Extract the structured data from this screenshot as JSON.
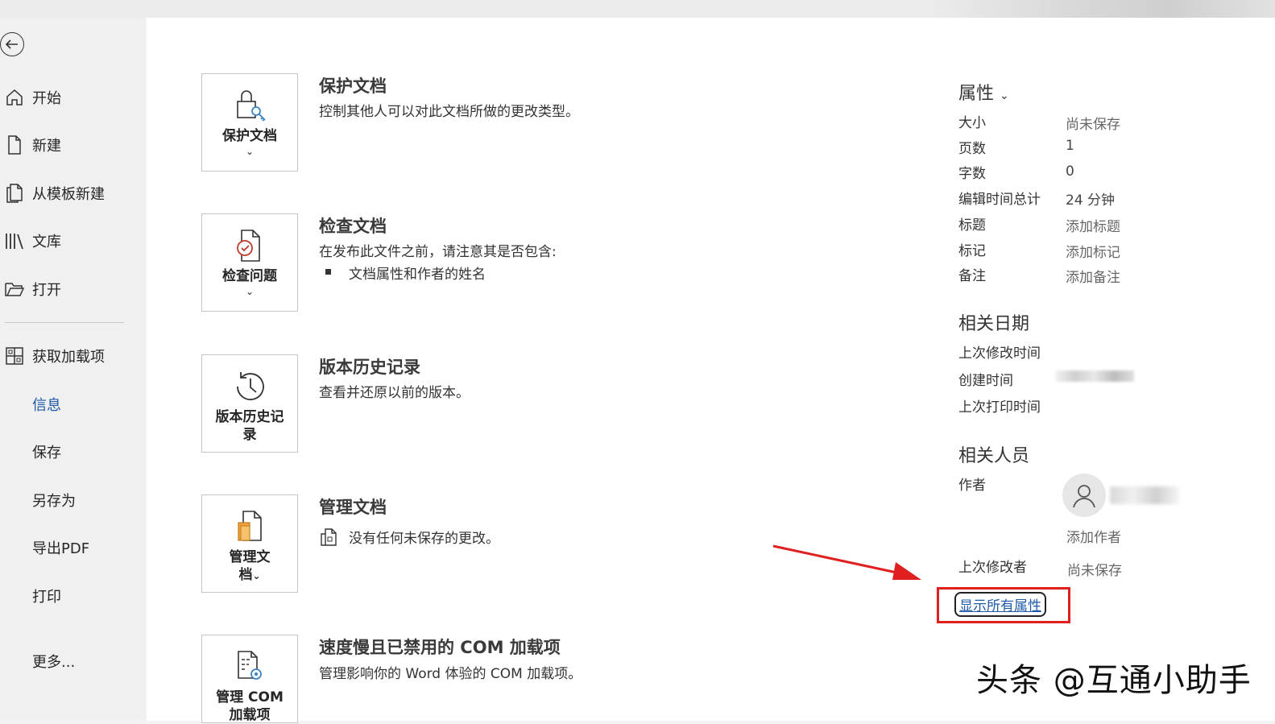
{
  "nav": {
    "items": [
      {
        "label": "开始",
        "icon": "home-icon"
      },
      {
        "label": "新建",
        "icon": "new-document-icon"
      },
      {
        "label": "从模板新建",
        "icon": "template-icon"
      },
      {
        "label": "文库",
        "icon": "library-icon"
      },
      {
        "label": "打开",
        "icon": "folder-open-icon"
      },
      {
        "label": "获取加载项",
        "icon": "addins-grid-icon"
      },
      {
        "label": "信息",
        "active": true
      },
      {
        "label": "保存"
      },
      {
        "label": "另存为"
      },
      {
        "label": "导出PDF"
      },
      {
        "label": "打印"
      },
      {
        "label": "更多..."
      }
    ]
  },
  "sections": [
    {
      "tile_label": "保护文档",
      "tile_chevron": "⌄",
      "title": "保护文档",
      "desc": "控制其他人可以对此文档所做的更改类型。",
      "icon": "lock-key-icon"
    },
    {
      "tile_label": "检查问题",
      "tile_chevron": "⌄",
      "title": "检查文档",
      "desc": "在发布此文件之前，请注意其是否包含:",
      "bullet": "文档属性和作者的姓名",
      "icon": "inspect-document-icon"
    },
    {
      "tile_label_line1": "版本历史记",
      "tile_label_line2": "录",
      "title": "版本历史记录",
      "desc": "查看并还原以前的版本。",
      "icon": "history-clock-icon"
    },
    {
      "tile_label_line1": "管理文",
      "tile_label_line2": "档",
      "tile_chevron": "⌄",
      "title": "管理文档",
      "desc": "没有任何未保存的更改。",
      "icon": "manage-document-icon"
    },
    {
      "tile_label_line1": "管理 COM",
      "tile_label_line2": "加载项",
      "title": "速度慢且已禁用的 COM 加载项",
      "desc": "管理影响你的 Word 体验的 COM 加载项。",
      "icon": "com-addins-icon"
    }
  ],
  "properties": {
    "heading": "属性",
    "heading_chevron": "⌄",
    "rows": [
      {
        "key": "大小",
        "value": "尚未保存"
      },
      {
        "key": "页数",
        "value": "1"
      },
      {
        "key": "字数",
        "value": "0"
      },
      {
        "key": "编辑时间总计",
        "value": "24 分钟"
      },
      {
        "key": "标题",
        "value": "添加标题"
      },
      {
        "key": "标记",
        "value": "添加标记"
      },
      {
        "key": "备注",
        "value": "添加备注"
      }
    ],
    "dates_heading": "相关日期",
    "dates": [
      {
        "key": "上次修改时间"
      },
      {
        "key": "创建时间"
      },
      {
        "key": "上次打印时间"
      }
    ],
    "people_heading": "相关人员",
    "author_key": "作者",
    "add_author": "添加作者",
    "last_modified_by_key": "上次修改者",
    "last_modified_by_value": "尚未保存",
    "show_all": "显示所有属性"
  },
  "watermark": "头条 @互通小助手",
  "colors": {
    "accent": "#1e5aa8",
    "highlight": "#e02020"
  }
}
